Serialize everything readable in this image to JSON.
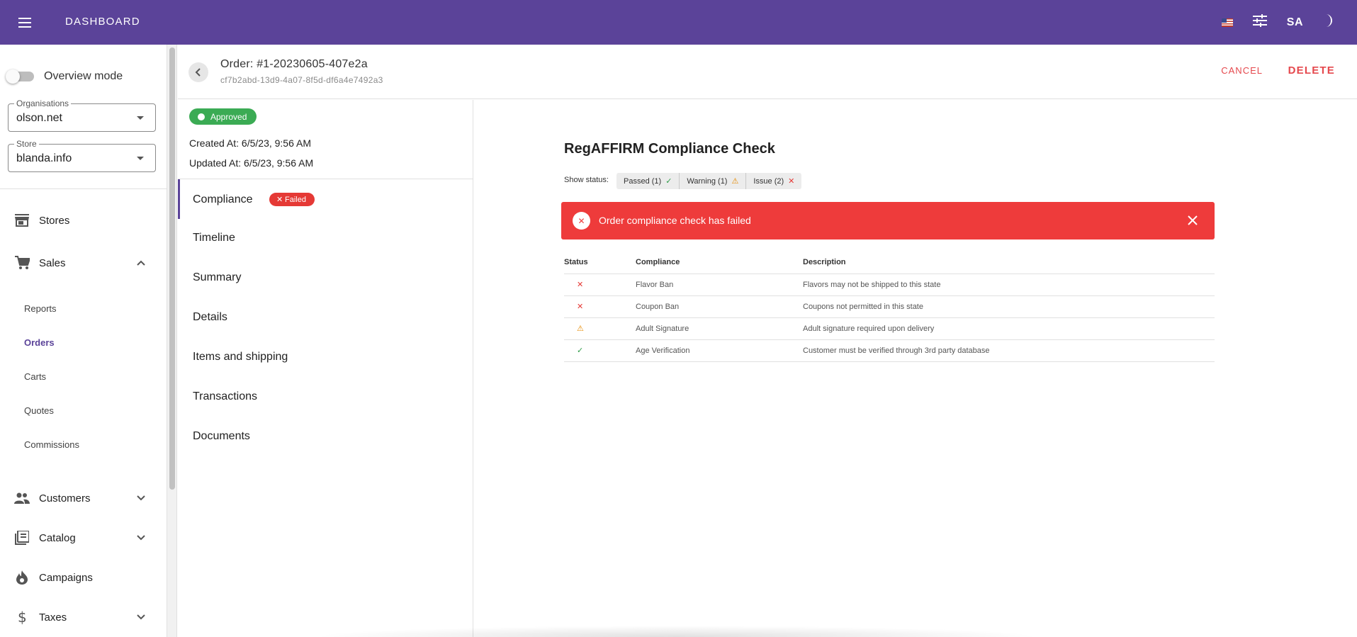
{
  "appbar": {
    "title": "DASHBOARD",
    "user_initials": "SA",
    "brand_color": "#5b4399"
  },
  "sidebar": {
    "overview_toggle_label": "Overview mode",
    "organisations": {
      "label": "Organisations",
      "value": "olson.net"
    },
    "store": {
      "label": "Store",
      "value": "blanda.info"
    },
    "nav": {
      "stores": "Stores",
      "sales": "Sales",
      "sales_sub": [
        "Reports",
        "Orders",
        "Carts",
        "Quotes",
        "Commissions"
      ],
      "customers": "Customers",
      "catalog": "Catalog",
      "campaigns": "Campaigns",
      "taxes": "Taxes"
    },
    "active_sub": "Orders"
  },
  "order": {
    "title": "Order: #1-20230605-407e2a",
    "uuid": "cf7b2abd-13d9-4a07-8f5d-df6a4e7492a3",
    "cancel_label": "CANCEL",
    "delete_label": "DELETE",
    "status": "Approved",
    "created_at": "Created At: 6/5/23, 9:56 AM",
    "updated_at": "Updated At: 6/5/23, 9:56 AM"
  },
  "sections": {
    "compliance": "Compliance",
    "compliance_badge": "Failed",
    "timeline": "Timeline",
    "summary": "Summary",
    "details": "Details",
    "items_shipping": "Items and shipping",
    "transactions": "Transactions",
    "documents": "Documents"
  },
  "compliance": {
    "title": "RegAFFIRM Compliance Check",
    "show_status_label": "Show status:",
    "filters": {
      "passed": "Passed (1)",
      "warning": "Warning (1)",
      "issue": "Issue (2)"
    },
    "alert_text": "Order compliance check has failed",
    "alert_color": "#ee3b3b",
    "columns": {
      "status": "Status",
      "compliance": "Compliance",
      "description": "Description"
    },
    "rows": [
      {
        "status": "issue",
        "compliance": "Flavor Ban",
        "description": "Flavors may not be shipped to this state"
      },
      {
        "status": "issue",
        "compliance": "Coupon Ban",
        "description": "Coupons not permitted in this state"
      },
      {
        "status": "warning",
        "compliance": "Adult Signature",
        "description": "Adult signature required upon delivery"
      },
      {
        "status": "passed",
        "compliance": "Age Verification",
        "description": "Customer must be verified through 3rd party database"
      }
    ]
  }
}
